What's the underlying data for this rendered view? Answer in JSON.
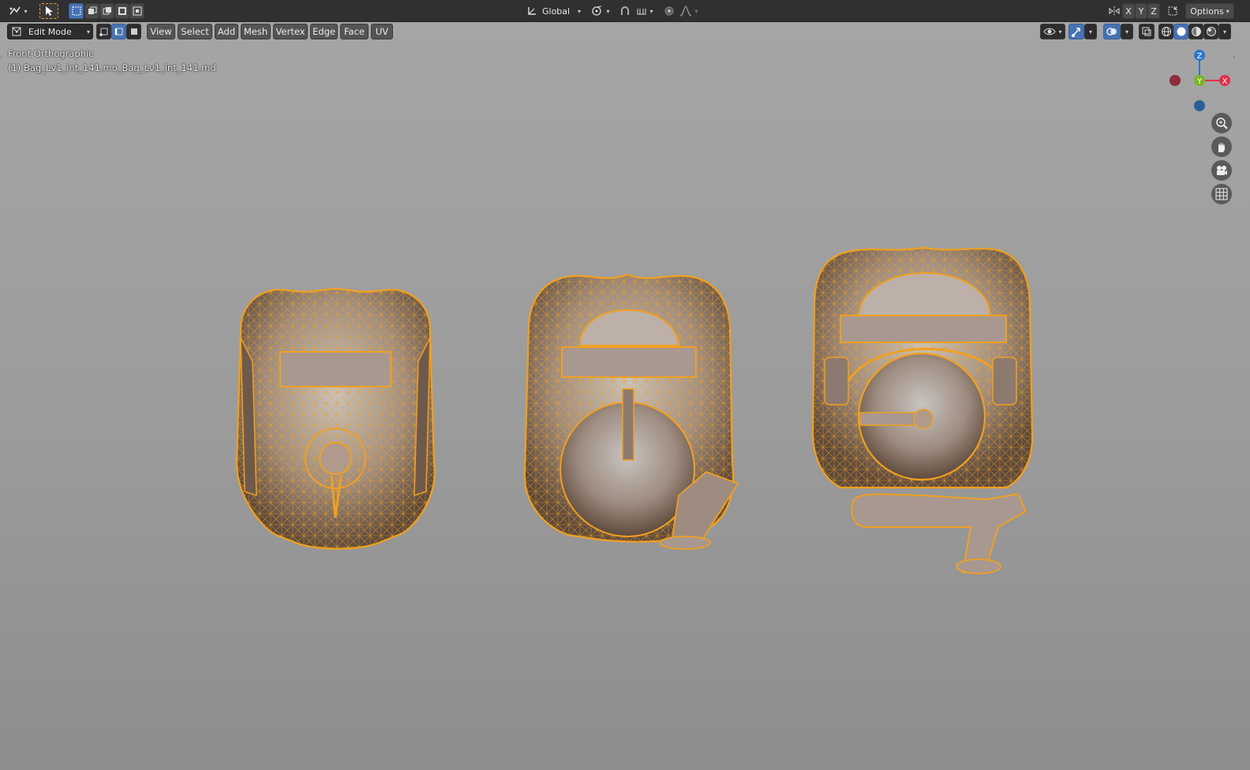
{
  "header": {
    "orientation_label": "Global",
    "options_label": "Options",
    "axis_x": "X",
    "axis_y": "Y",
    "axis_z": "Z"
  },
  "toolbar": {
    "mode_label": "Edit Mode",
    "menus": [
      "View",
      "Select",
      "Add",
      "Mesh",
      "Vertex",
      "Edge",
      "Face",
      "UV"
    ]
  },
  "viewport": {
    "view_name": "Front Orthographic",
    "object_info": "(1) Bag_Lv1_int_141.mo_Bag_Lv1_int_141.md"
  },
  "gizmo": {
    "z": "Z",
    "y": "Y",
    "x": "X"
  },
  "colors": {
    "wire": "#f0a020",
    "axis_x": "#e0304a",
    "axis_y": "#7ab624",
    "axis_z": "#2c75cc",
    "active": "#4772b3"
  },
  "icons": [
    "editor-type-icon",
    "cursor-select-icon",
    "box-select-icon",
    "transform-orientation-icon",
    "pivot-icon",
    "snap-icon",
    "proportional-icon",
    "falloff-icon",
    "mirror-icon",
    "overlay-icon",
    "xray-icon",
    "shading-wire-icon",
    "shading-solid-icon",
    "shading-material-icon",
    "shading-rendered-icon",
    "zoom-icon",
    "pan-hand-icon",
    "camera-icon",
    "grid-icon"
  ]
}
